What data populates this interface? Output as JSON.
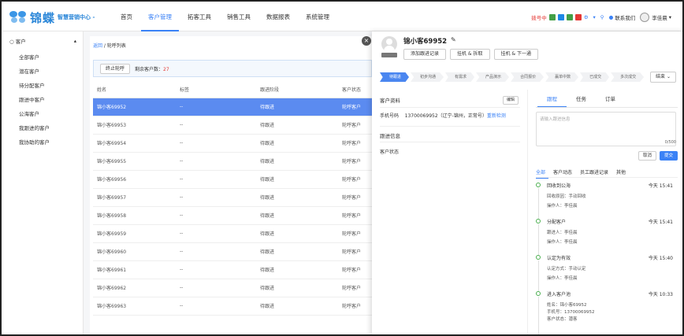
{
  "brand": {
    "name": "锦蝶",
    "subtitle": "智慧营销中心 -"
  },
  "nav": [
    "首页",
    "客户管理",
    "拓客工具",
    "销售工具",
    "数据报表",
    "系统管理"
  ],
  "nav_active": 1,
  "topright": {
    "status": "拨号中",
    "contact": "联系我们",
    "user": "李佳晨"
  },
  "sidebar": {
    "title": "客户",
    "items": [
      "全部客户",
      "潜在客户",
      "待分配客户",
      "跟进中客户",
      "公海客户",
      "我跟进的客户",
      "我协助的客户"
    ]
  },
  "breadcrumb": {
    "link": "返回",
    "current": " / 轮呼列表"
  },
  "controls": {
    "stop_button": "终止轮呼",
    "remaining_label": "剩余客户数：",
    "remaining_count": "27"
  },
  "table": {
    "headers": [
      "姓名",
      "标签",
      "跟进阶段",
      "客户状态"
    ],
    "rows": [
      [
        "锦小客69952",
        "--",
        "待跟进",
        "轮呼客户"
      ],
      [
        "锦小客69953",
        "--",
        "待跟进",
        "轮呼客户"
      ],
      [
        "锦小客69954",
        "--",
        "待跟进",
        "轮呼客户"
      ],
      [
        "锦小客69955",
        "--",
        "待跟进",
        "轮呼客户"
      ],
      [
        "锦小客69956",
        "--",
        "待跟进",
        "轮呼客户"
      ],
      [
        "锦小客69957",
        "--",
        "待跟进",
        "轮呼客户"
      ],
      [
        "锦小客69958",
        "--",
        "待跟进",
        "轮呼客户"
      ],
      [
        "锦小客69959",
        "--",
        "待跟进",
        "轮呼客户"
      ],
      [
        "锦小客69960",
        "--",
        "待跟进",
        "轮呼客户"
      ],
      [
        "锦小客69961",
        "--",
        "待跟进",
        "轮呼客户"
      ],
      [
        "锦小客69962",
        "--",
        "待跟进",
        "轮呼客户"
      ],
      [
        "锦小客69963",
        "--",
        "待跟进",
        "轮呼客户"
      ]
    ],
    "selected_row": 0
  },
  "panel": {
    "avatar_tag": "",
    "name": "锦小客69952",
    "buttons": [
      "添加跟进记录",
      "挂机 & 拆取",
      "挂机 & 下一通"
    ],
    "stages": [
      "待跟进",
      "初步沟通",
      "有需求",
      "产品演示",
      "合同报价",
      "赢单中数",
      "已成交",
      "多次成交"
    ],
    "stage_active": 0,
    "stage_more": "结束",
    "customer_info_title": "客户资料",
    "edit_label": "编辑",
    "phone_label": "手机号码",
    "phone_value": "13700069952（辽宁-锦州，正常号）",
    "phone_link": "重新检测",
    "followup_title": "跟进信息",
    "customer_status_label": "客户状态",
    "right_tabs": [
      "跟程",
      "任务",
      "订单"
    ],
    "right_tab_active": 0,
    "textarea_placeholder": "请输入跟进信息",
    "char_count": "0/500",
    "cancel": "取消",
    "submit": "提交",
    "filter_tabs": [
      "全部",
      "客户动态",
      "员工跟进记录",
      "其他"
    ],
    "filter_active": 0,
    "timeline": [
      {
        "title": "回收到公海",
        "time": "今天 15:41",
        "lines": [
          "回收原因：手动回收",
          "操作人：李佳晨"
        ]
      },
      {
        "title": "分配客户",
        "time": "今天 15:41",
        "lines": [
          "跟进人：李佳晨",
          "操作人：李佳晨"
        ]
      },
      {
        "title": "认定为有效",
        "time": "今天 15:40",
        "lines": [
          "认定方式：手动认定",
          "操作人：李佳晨"
        ]
      },
      {
        "title": "进入客户池",
        "time": "今天 10:33",
        "lines": [
          "姓名：锦小客69952",
          "手机号：13700069952",
          "客户状态：潜客"
        ]
      }
    ]
  }
}
